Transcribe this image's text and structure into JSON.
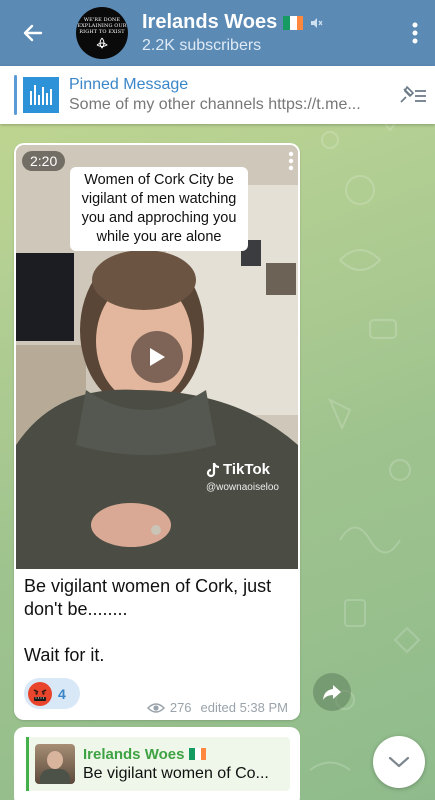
{
  "header": {
    "title": "Irelands Woes",
    "subtitle": "2.2K subscribers",
    "avatar_text": [
      "WE'RE DONE",
      "EXPLAINING OUR",
      "RIGHT TO EXIST"
    ],
    "colors": {
      "bar": "#5b8ab5"
    }
  },
  "pinned": {
    "title": "Pinned Message",
    "body": "Some of my other channels  https://t.me..."
  },
  "message": {
    "video": {
      "duration": "2:20",
      "caption": "Women of Cork City be vigilant of men watching you and approching you while you are alone",
      "watermark_brand": "TikTok",
      "watermark_user": "@wownaoiseloo"
    },
    "text_line1": "Be vigilant women of Cork, just don't be........",
    "text_line2": "Wait for it.",
    "reaction": {
      "emoji": "angry-face-symbols",
      "count": "4"
    },
    "views": "276",
    "edited_time": "edited 5:38 PM"
  },
  "next_message": {
    "reply_title": "Irelands Woes",
    "reply_body": "Be vigilant women of Co..."
  },
  "colors": {
    "accent": "#3a86c8",
    "reply_green": "#3fa244",
    "flag": [
      "#169b62",
      "#ffffff",
      "#ff883e"
    ]
  }
}
